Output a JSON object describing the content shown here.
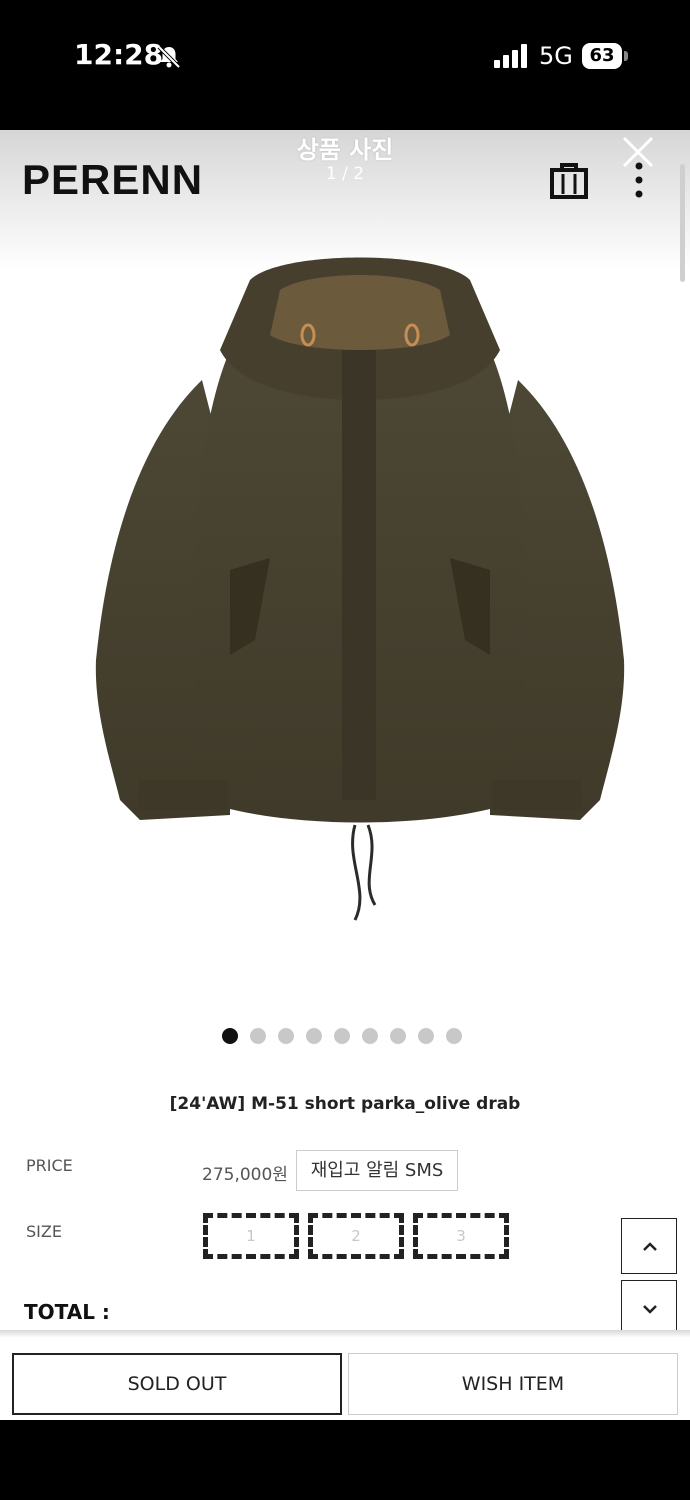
{
  "status_bar": {
    "time": "12:28",
    "network": "5G",
    "battery": "63"
  },
  "viewer": {
    "title": "상품 사진",
    "counter": "1 / 2"
  },
  "brand": {
    "logo": "PERENN"
  },
  "gallery": {
    "dot_count": 9,
    "active_index": 0
  },
  "product": {
    "name": "[24'AW] M-51 short parka_olive drab",
    "price_label": "PRICE",
    "price": "275,000원",
    "restock_button": "재입고 알림 SMS",
    "size_label": "SIZE",
    "sizes": [
      "1",
      "2",
      "3"
    ],
    "total_label": "TOTAL :"
  },
  "actions": {
    "sold_out": "SOLD OUT",
    "wish": "WISH ITEM"
  },
  "colors": {
    "jacket": "#4a4433",
    "jacket_dark": "#35301f",
    "hood_lining": "#6b5a3b"
  }
}
